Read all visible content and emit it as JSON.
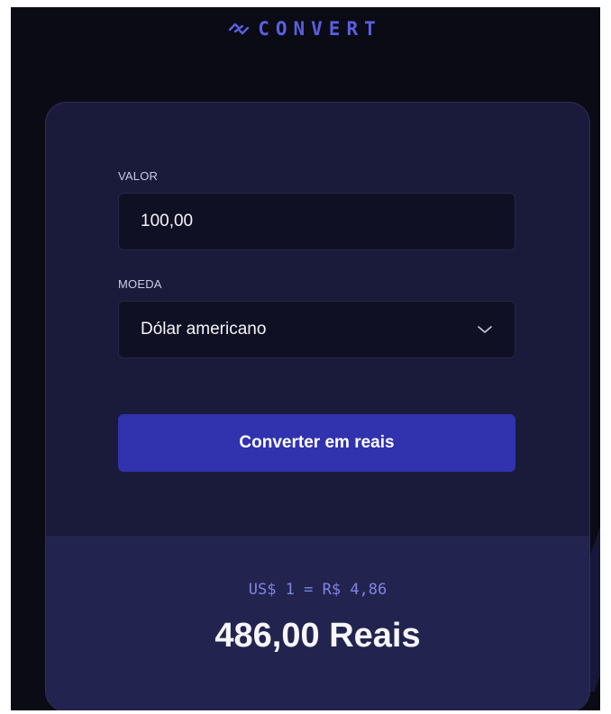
{
  "header": {
    "logo_text": "CONVERT",
    "logo_icon": "convert-arrows-icon"
  },
  "form": {
    "amount_label": "VALOR",
    "amount_value": "100,00",
    "currency_label": "MOEDA",
    "currency_selected": "Dólar americano",
    "currency_icon": "chevron-down-icon",
    "submit_label": "Converter em reais"
  },
  "result": {
    "rate_text": "US$ 1 = R$ 4,86",
    "total_text": "486,00 Reais"
  },
  "colors": {
    "background": "#0b0b16",
    "card": "#1a1a3b",
    "result_panel": "#23234f",
    "accent": "#3032ae",
    "logo": "#5a5fe0"
  }
}
